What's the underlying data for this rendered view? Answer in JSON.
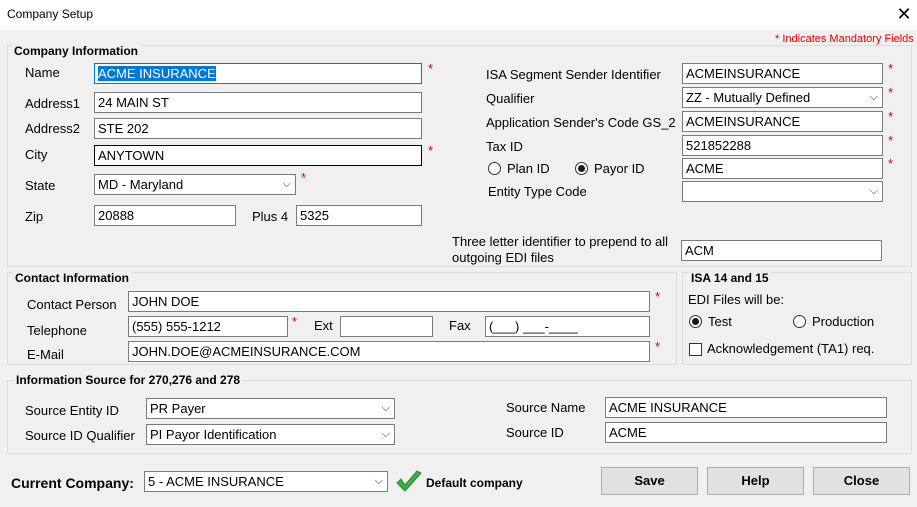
{
  "window": {
    "title": "Company Setup",
    "close_glyph": "✕"
  },
  "mandatory_note": "* Indicates Mandatory Fields",
  "company_info": {
    "group_title": "Company Information",
    "name_label": "Name",
    "name_value": "ACME INSURANCE",
    "address1_label": "Address1",
    "address1_value": "24 MAIN ST",
    "address2_label": "Address2",
    "address2_value": "STE 202",
    "city_label": "City",
    "city_value": "ANYTOWN",
    "state_label": "State",
    "state_value": "MD - Maryland",
    "zip_label": "Zip",
    "zip_value": "20888",
    "plus4_label": "Plus 4",
    "plus4_value": "5325",
    "isa_label": "ISA Segment Sender Identifier",
    "isa_value": "ACMEINSURANCE",
    "qualifier_label": "Qualifier",
    "qualifier_value": "ZZ - Mutually Defined",
    "appcode_label": "Application Sender's Code GS_2",
    "appcode_value": "ACMEINSURANCE",
    "taxid_label": "Tax ID",
    "taxid_value": "521852288",
    "plan_id_label": "Plan ID",
    "payor_id_label": "Payor ID",
    "payor_value": "ACME",
    "entity_type_label": "Entity Type Code",
    "entity_type_value": "",
    "three_letter_label_1": "Three letter identifier to prepend to all",
    "three_letter_label_2": "outgoing EDI files",
    "three_letter_value": "ACM"
  },
  "contact_info": {
    "group_title": "Contact Information",
    "person_label": "Contact Person",
    "person_value": "JOHN DOE",
    "telephone_label": "Telephone",
    "telephone_value": "(555) 555-1212",
    "ext_label": "Ext",
    "ext_value": "",
    "fax_label": "Fax",
    "fax_value": "(___) ___-____",
    "email_label": "E-Mail",
    "email_value": "JOHN.DOE@ACMEINSURANCE.COM"
  },
  "isa1415": {
    "group_title": "ISA 14 and 15",
    "edi_label": "EDI Files will be:",
    "test_label": "Test",
    "production_label": "Production",
    "ack_label": "Acknowledgement (TA1) req."
  },
  "info_source": {
    "group_title": "Information Source for 270,276 and 278",
    "entity_id_label": "Source Entity ID",
    "entity_id_value": "PR Payer",
    "id_qual_label": "Source ID Qualifier",
    "id_qual_value": "PI Payor Identification",
    "source_name_label": "Source Name",
    "source_name_value": "ACME INSURANCE",
    "source_id_label": "Source ID",
    "source_id_value": "ACME"
  },
  "footer": {
    "current_company_label": "Current Company:",
    "current_company_value": "5 - ACME INSURANCE",
    "default_company_label": "Default company",
    "save_label": "Save",
    "help_label": "Help",
    "close_label": "Close"
  },
  "icons": {
    "dropdown": "chevron-down-icon",
    "default": "checkmark-icon"
  },
  "colors": {
    "mandatory": "#e00000",
    "selection": "#0078d7",
    "check_green": "#3cb043"
  },
  "star": "*",
  "arrow": "⌵"
}
